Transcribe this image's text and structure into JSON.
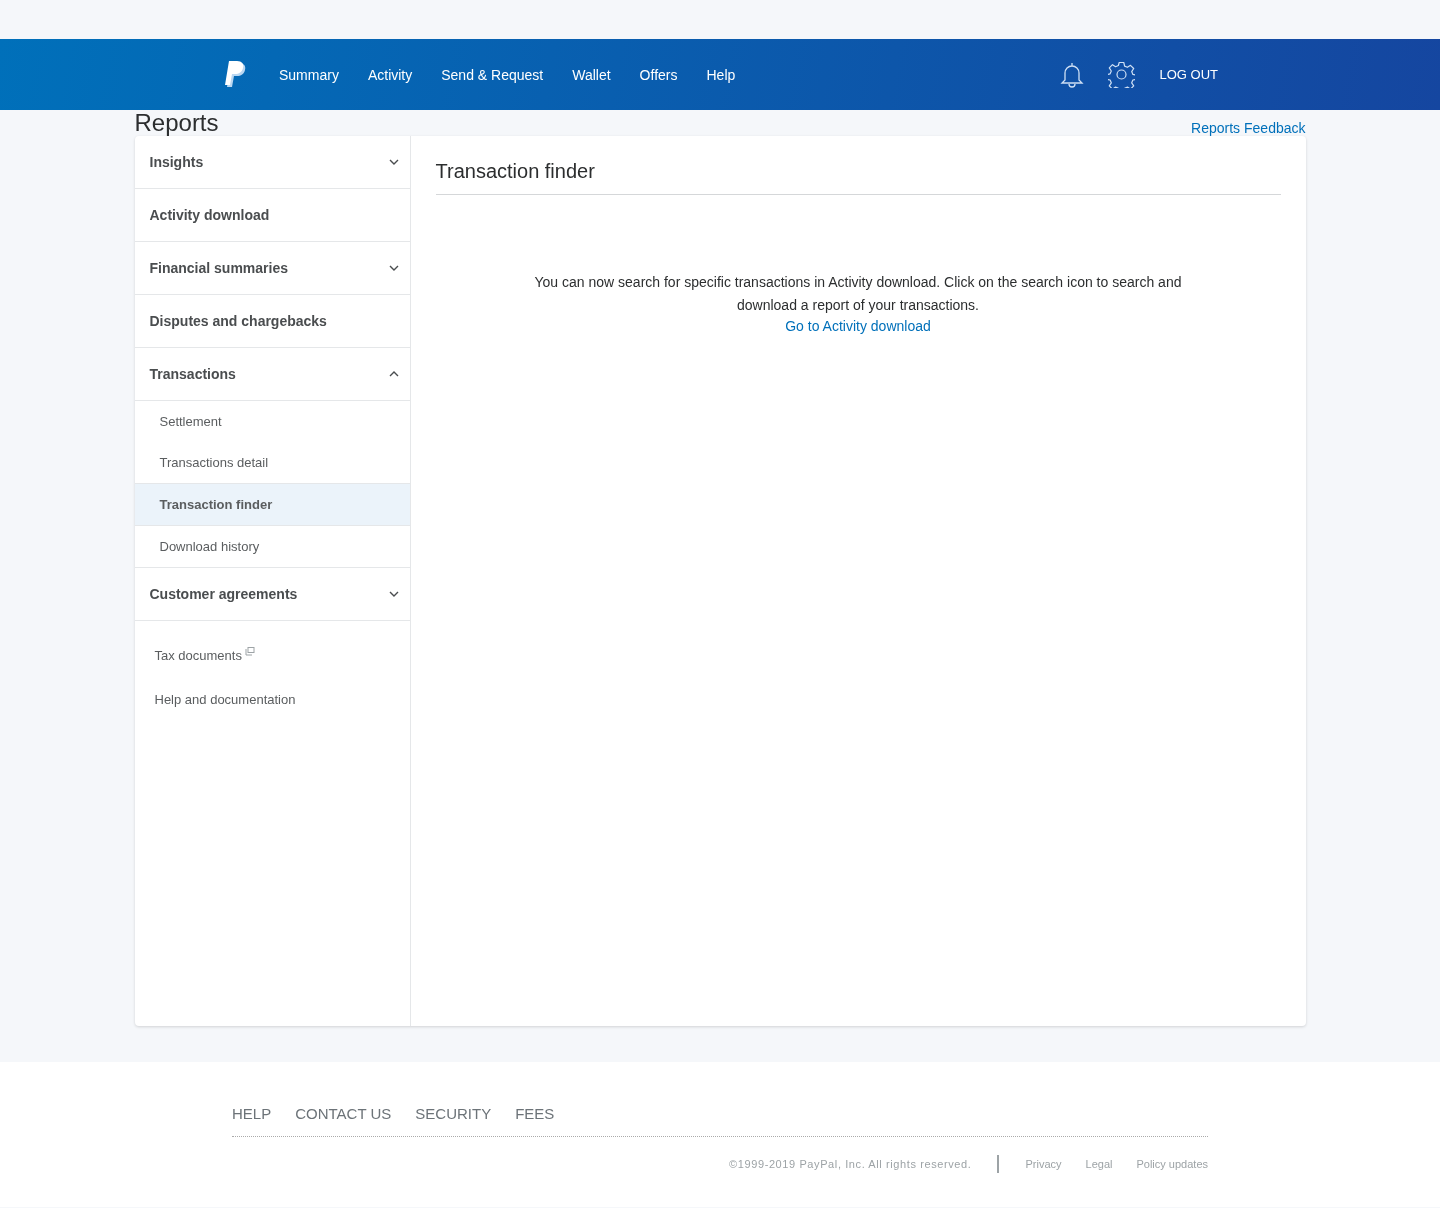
{
  "nav": {
    "items": [
      {
        "label": "Summary"
      },
      {
        "label": "Activity"
      },
      {
        "label": "Send & Request"
      },
      {
        "label": "Wallet"
      },
      {
        "label": "Offers"
      },
      {
        "label": "Help"
      }
    ],
    "logout": "LOG OUT"
  },
  "page": {
    "title": "Reports",
    "feedback": "Reports Feedback"
  },
  "sidebar": {
    "sections": [
      {
        "label": "Insights",
        "kind": "group",
        "expanded": false
      },
      {
        "label": "Activity download",
        "kind": "link"
      },
      {
        "label": "Financial summaries",
        "kind": "group",
        "expanded": false
      },
      {
        "label": "Disputes and chargebacks",
        "kind": "link"
      },
      {
        "label": "Transactions",
        "kind": "group",
        "expanded": true,
        "children": [
          {
            "label": "Settlement",
            "selected": false
          },
          {
            "label": "Transactions detail",
            "selected": false
          },
          {
            "label": "Transaction finder",
            "selected": true
          },
          {
            "label": "Download history",
            "selected": false
          }
        ]
      },
      {
        "label": "Customer agreements",
        "kind": "group",
        "expanded": false
      }
    ],
    "links": [
      {
        "label": "Tax documents",
        "external": true
      },
      {
        "label": "Help and documentation",
        "external": false
      }
    ]
  },
  "content": {
    "title": "Transaction finder",
    "message": "You can now search for specific transactions in Activity download. Click on the search icon to search and download a report of your transactions.",
    "link": "Go to Activity download"
  },
  "footer": {
    "links": [
      "HELP",
      "CONTACT US",
      "SECURITY",
      "FEES"
    ],
    "copyright": "©1999-2019 PayPal, Inc. All rights reserved.",
    "legal": [
      "Privacy",
      "Legal",
      "Policy updates"
    ]
  }
}
